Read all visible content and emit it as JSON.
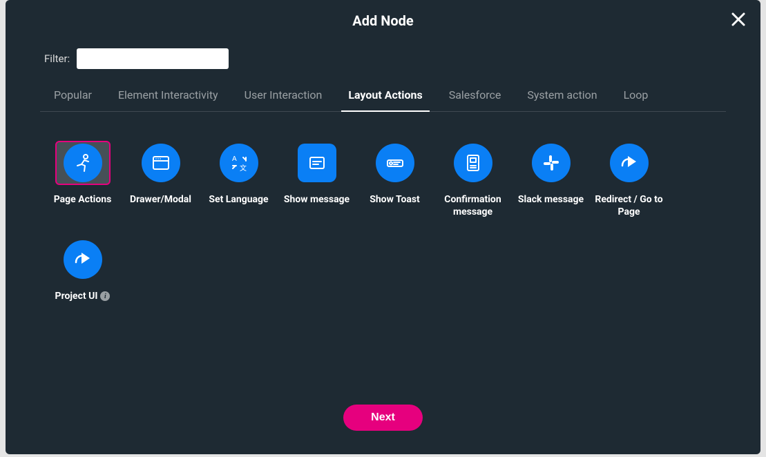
{
  "modal": {
    "title": "Add Node",
    "filter_label": "Filter:",
    "filter_value": "",
    "tabs": [
      {
        "label": "Popular",
        "active": false
      },
      {
        "label": "Element Interactivity",
        "active": false
      },
      {
        "label": "User Interaction",
        "active": false
      },
      {
        "label": "Layout Actions",
        "active": true
      },
      {
        "label": "Salesforce",
        "active": false
      },
      {
        "label": "System action",
        "active": false
      },
      {
        "label": "Loop",
        "active": false
      }
    ],
    "cards": [
      {
        "label": "Page Actions",
        "icon": "runner-icon",
        "shape": "circle",
        "selected": true,
        "info": false
      },
      {
        "label": "Drawer/Modal",
        "icon": "window-icon",
        "shape": "circle",
        "selected": false,
        "info": false
      },
      {
        "label": "Set Language",
        "icon": "translate-icon",
        "shape": "circle",
        "selected": false,
        "info": false
      },
      {
        "label": "Show message",
        "icon": "message-box-icon",
        "shape": "square",
        "selected": false,
        "info": false
      },
      {
        "label": "Show Toast",
        "icon": "toast-icon",
        "shape": "circle",
        "selected": false,
        "info": false
      },
      {
        "label": "Confirmation message",
        "icon": "document-icon",
        "shape": "circle",
        "selected": false,
        "info": false
      },
      {
        "label": "Slack message",
        "icon": "slack-icon",
        "shape": "circle",
        "selected": false,
        "info": false
      },
      {
        "label": "Redirect / Go to Page",
        "icon": "redirect-arrow-icon",
        "shape": "circle",
        "selected": false,
        "info": false
      },
      {
        "label": "Project UI",
        "icon": "redirect-arrow-icon",
        "shape": "circle",
        "selected": false,
        "info": true
      }
    ],
    "next_label": "Next"
  }
}
